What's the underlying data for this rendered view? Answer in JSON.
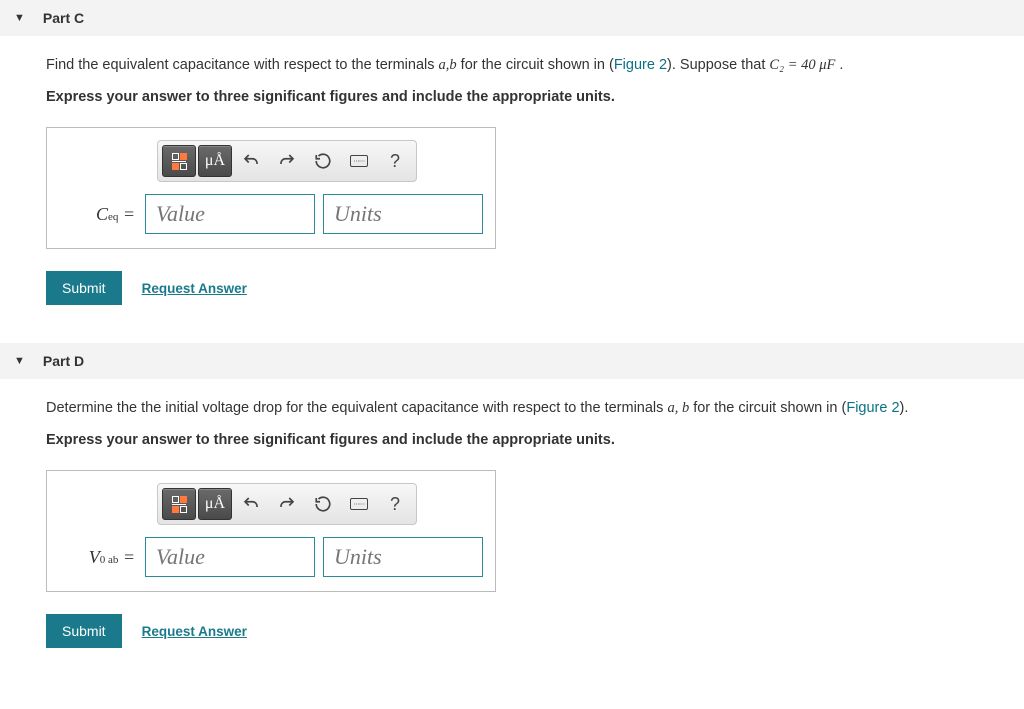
{
  "parts": [
    {
      "id": "C",
      "title": "Part C",
      "question_prefix": "Find the equivalent capacitance with respect to the terminals ",
      "terminals": "a,b",
      "question_mid": " for the circuit shown in (",
      "figure_link": "Figure 2",
      "question_suffix1": "). Suppose that ",
      "given_expr": "C₂ = 40  μF",
      "question_suffix2": " .",
      "instruction": "Express your answer to three significant figures and include the appropriate units.",
      "var_label_html": "C<sub>eq</sub> =",
      "value_placeholder": "Value",
      "units_placeholder": "Units",
      "submit_label": "Submit",
      "request_label": "Request Answer",
      "toolbar": {
        "mu_a": "μÅ",
        "help": "?"
      }
    },
    {
      "id": "D",
      "title": "Part D",
      "question_prefix": "Determine the the initial voltage drop for the equivalent capacitance with respect to the terminals ",
      "terminals": "a, b",
      "question_mid": " for the circuit shown in (",
      "figure_link": "Figure 2",
      "question_suffix1": ").",
      "given_expr": "",
      "question_suffix2": "",
      "instruction": "Express your answer to three significant figures and include the appropriate units.",
      "var_label_html": "V<sub>0 ab</sub> =",
      "value_placeholder": "Value",
      "units_placeholder": "Units",
      "submit_label": "Submit",
      "request_label": "Request Answer",
      "toolbar": {
        "mu_a": "μÅ",
        "help": "?"
      }
    }
  ]
}
